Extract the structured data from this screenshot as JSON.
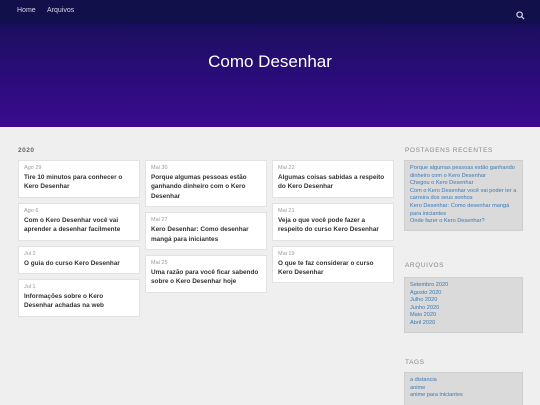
{
  "nav": {
    "home": "Home",
    "arquivos": "Arquivos"
  },
  "hero": {
    "title": "Como Desenhar",
    "colors": {
      "top": "#1a0f5e",
      "bottom": "#3a0b8f"
    }
  },
  "year_heading": "2020",
  "columns": [
    [
      {
        "date": "Ago 29",
        "title": "Tire 10 minutos para conhecer o Kero Desenhar"
      },
      {
        "date": "Ago 6",
        "title": "Com o Kero Desenhar você vai aprender a desenhar facilmente"
      },
      {
        "date": "Jul 2",
        "title": "O guia do curso Kero Desenhar"
      },
      {
        "date": "Jul 1",
        "title": "Informações sobre o Kero Desenhar achadas na web"
      }
    ],
    [
      {
        "date": "Mai 30",
        "title": "Porque algumas pessoas estão ganhando dinheiro com o Kero Desenhar"
      },
      {
        "date": "Mai 27",
        "title": "Kero Desenhar: Como desenhar mangá para iniciantes"
      },
      {
        "date": "Mai 25",
        "title": "Uma razão para você ficar sabendo sobre o Kero Desenhar hoje"
      }
    ],
    [
      {
        "date": "Mai 22",
        "title": "Algumas coisas sabidas a respeito do Kero Desenhar"
      },
      {
        "date": "Mai 21",
        "title": "Veja o que você pode fazer a respeito do curso Kero Desenhar"
      },
      {
        "date": "Mai 19",
        "title": "O que te faz considerar o curso Kero Desenhar"
      }
    ]
  ],
  "sidebar": {
    "recent_heading": "POSTAGENS RECENTES",
    "recent": [
      "Porque algumas pessoas estão ganhando dinheiro com o Kero Desenhar",
      "Chegou o Kero Desenhar",
      "Com o Kero Desenhar você vai poder ter a carreira dos seus sonhos",
      "Kero Desenhar: Como desenhar mangá para iniciantes",
      "Onde fazer o Kero Desenhar?"
    ],
    "archive_heading": "ARQUIVOS",
    "archives": [
      "Setembro 2020",
      "Agosto 2020",
      "Julho 2020",
      "Junho 2020",
      "Maio 2020",
      "Abril 2020"
    ],
    "tags_heading": "TAGS",
    "tags": [
      "a distancia",
      "anime",
      "anime para iniciantes"
    ]
  },
  "icons": {
    "search": "search-icon"
  }
}
